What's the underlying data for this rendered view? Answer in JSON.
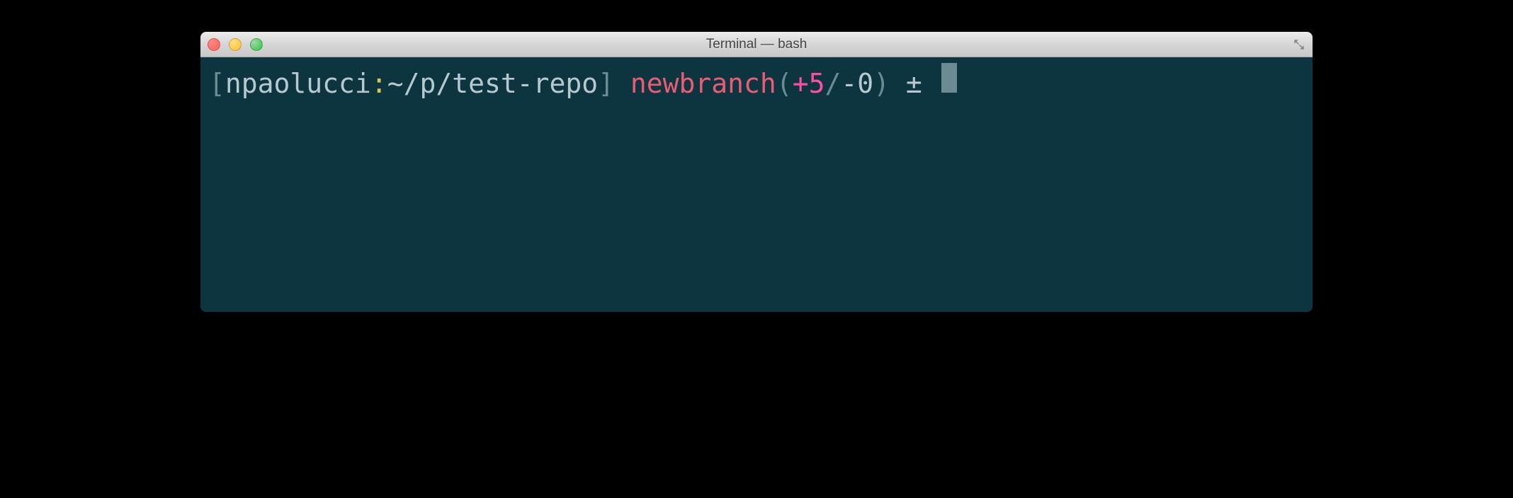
{
  "window": {
    "title": "Terminal — bash"
  },
  "prompt": {
    "open_bracket": "[",
    "username": "npaolucci",
    "colon": ":",
    "path": "~/p/test-repo",
    "close_bracket": "]",
    "branch": "newbranch",
    "open_paren": "(",
    "additions": "+5",
    "slash": "/",
    "deletions": "-0",
    "close_paren": ")",
    "plusminus": "±"
  }
}
